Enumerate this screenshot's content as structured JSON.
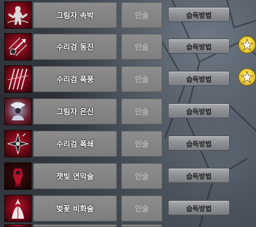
{
  "skills": [
    {
      "name": "그림자 속박",
      "condition": "인술",
      "acquire_label": "습득방법",
      "icon": "shadow-bind-icon",
      "badge": false
    },
    {
      "name": "수리검 동진",
      "condition": "인술",
      "acquire_label": "습득방법",
      "icon": "shuriken-dash-icon",
      "badge": true
    },
    {
      "name": "수리검 폭풍",
      "condition": "인술",
      "acquire_label": "습득방법",
      "icon": "shuriken-storm-icon",
      "badge": true
    },
    {
      "name": "그림자 은신",
      "condition": "인술",
      "acquire_label": "습득방법",
      "icon": "shadow-stealth-icon",
      "badge": false
    },
    {
      "name": "수리검 폭쇄",
      "condition": "인술",
      "acquire_label": "습득방법",
      "icon": "shuriken-burst-icon",
      "badge": false
    },
    {
      "name": "잿빛 연막술",
      "condition": "인술",
      "acquire_label": "습득방법",
      "icon": "ash-smoke-icon",
      "badge": false
    },
    {
      "name": "벚꽃 비화술",
      "condition": "인술",
      "acquire_label": "습득방법",
      "icon": "cherry-blossom-icon",
      "badge": false
    }
  ],
  "colors": {
    "icon_bg": "#8a0b1e",
    "cell_bg": "#858585",
    "button_bg": "#9a9ea2",
    "badge": "#f1d43c"
  }
}
